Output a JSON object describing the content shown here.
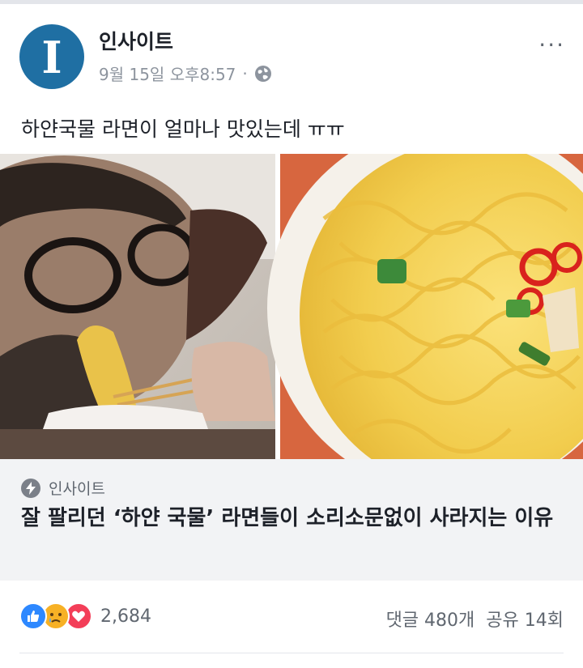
{
  "post": {
    "page_name": "인사이트",
    "avatar_letter": "I",
    "timestamp": "9월 15일 오후8:57",
    "separator": "·",
    "more_label": "···",
    "text": "하얀국물 라면이 얼마나 맛있는데 ㅠㅠ",
    "avatar_color": "#1f6fa3"
  },
  "link": {
    "source": "인사이트",
    "title": "잘 팔리던 ‘하얀 국물’ 라면들이 소리소문없이 사라지는 이유"
  },
  "stats": {
    "reaction_count": "2,684",
    "comments": "댓글 480개",
    "shares": "공유 14회"
  },
  "icons": {
    "reactions": [
      "like-icon",
      "sad-icon",
      "love-icon"
    ],
    "privacy": "globe-icon",
    "source": "bolt-icon",
    "menu": "more-icon"
  }
}
